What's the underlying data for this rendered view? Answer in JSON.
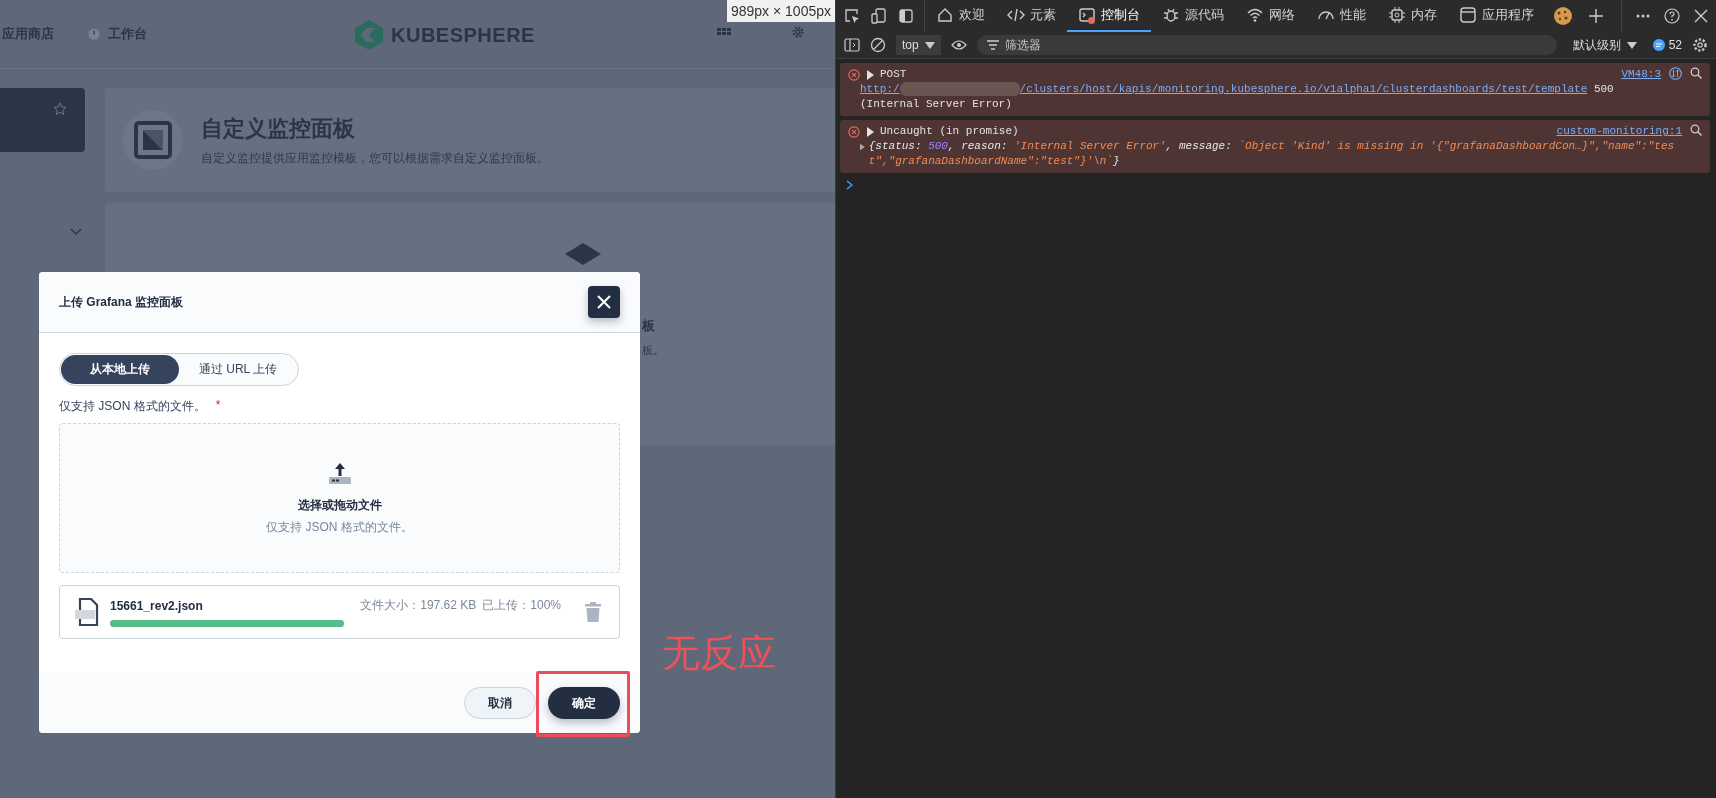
{
  "page": {
    "nav": [
      {
        "label": "应用商店"
      },
      {
        "label": "工作台"
      }
    ],
    "logo": "KUBESPHERE",
    "banner": {
      "title": "自定义监控面板",
      "subtitle": "自定义监控提供应用监控模板，您可以根据需求自定义监控面板。"
    },
    "empty_card": {
      "title": "板",
      "subtitle": "板。"
    },
    "viewport_size": "989px × 1005px"
  },
  "dialog": {
    "title": "上传 Grafana 监控面板",
    "modes": [
      {
        "label": "从本地上传",
        "selected": true
      },
      {
        "label": "通过 URL 上传",
        "selected": false
      }
    ],
    "field_label": "仅支持 JSON 格式的文件。",
    "required_mark": "*",
    "dropzone": {
      "title": "选择或拖动文件",
      "hint": "仅支持 JSON 格式的文件。"
    },
    "file": {
      "name": "15661_rev2.json",
      "size": "文件大小：197.62 KB",
      "uploaded": "已上传：100%",
      "level": 1
    },
    "buttons": [
      {
        "label": "取消",
        "kind": "secondary",
        "highlighted": false
      },
      {
        "label": "确定",
        "kind": "primary",
        "highlighted": true
      }
    ]
  },
  "annotation": "无反应",
  "devtools": {
    "tabs": [
      {
        "label": "欢迎",
        "selected": false,
        "has_errors": false
      },
      {
        "label": "元素",
        "selected": false,
        "has_errors": false
      },
      {
        "label": "控制台",
        "selected": true,
        "has_errors": true
      },
      {
        "label": "源代码",
        "selected": false,
        "has_errors": false
      },
      {
        "label": "网络",
        "selected": false,
        "has_errors": false
      },
      {
        "label": "性能",
        "selected": false,
        "has_errors": false
      },
      {
        "label": "内存",
        "selected": false,
        "has_errors": false
      },
      {
        "label": "应用程序",
        "selected": false,
        "has_errors": false
      }
    ],
    "context": "top",
    "filter_placeholder": "筛选器",
    "log_level": "默认级别",
    "message_count": "52",
    "messages": [
      {
        "kind": "network",
        "method": "POST",
        "url_start": "http:/",
        "url_rest": "/clusters/host/kapis/monitoring.kubesphere.io/v1alpha1/clusterdashboards/test/template",
        "status": "500",
        "status_text": "(Internal Server Error)",
        "source": "VM48:3"
      },
      {
        "kind": "exception",
        "text": "Uncaught (in promise)",
        "source": "custom-monitoring:1",
        "tokens": [
          {
            "kind": "punct",
            "text": "{"
          },
          {
            "kind": "key",
            "text": "status"
          },
          {
            "kind": "punct",
            "text": ": "
          },
          {
            "kind": "number",
            "text": "500"
          },
          {
            "kind": "punct",
            "text": ", "
          },
          {
            "kind": "key",
            "text": "reason"
          },
          {
            "kind": "punct",
            "text": ": "
          },
          {
            "kind": "string",
            "text": "'Internal Server Error'"
          },
          {
            "kind": "punct",
            "text": ", "
          },
          {
            "kind": "key",
            "text": "message"
          },
          {
            "kind": "punct",
            "text": ": "
          },
          {
            "kind": "string",
            "text": "`Object 'Kind' is missing in '{\"grafanaDashboardCon…}\",\"name\":\"test\",\"grafanaDashboardName\":\"test\"}'\\n`"
          },
          {
            "kind": "punct",
            "text": "}"
          }
        ]
      }
    ]
  }
}
